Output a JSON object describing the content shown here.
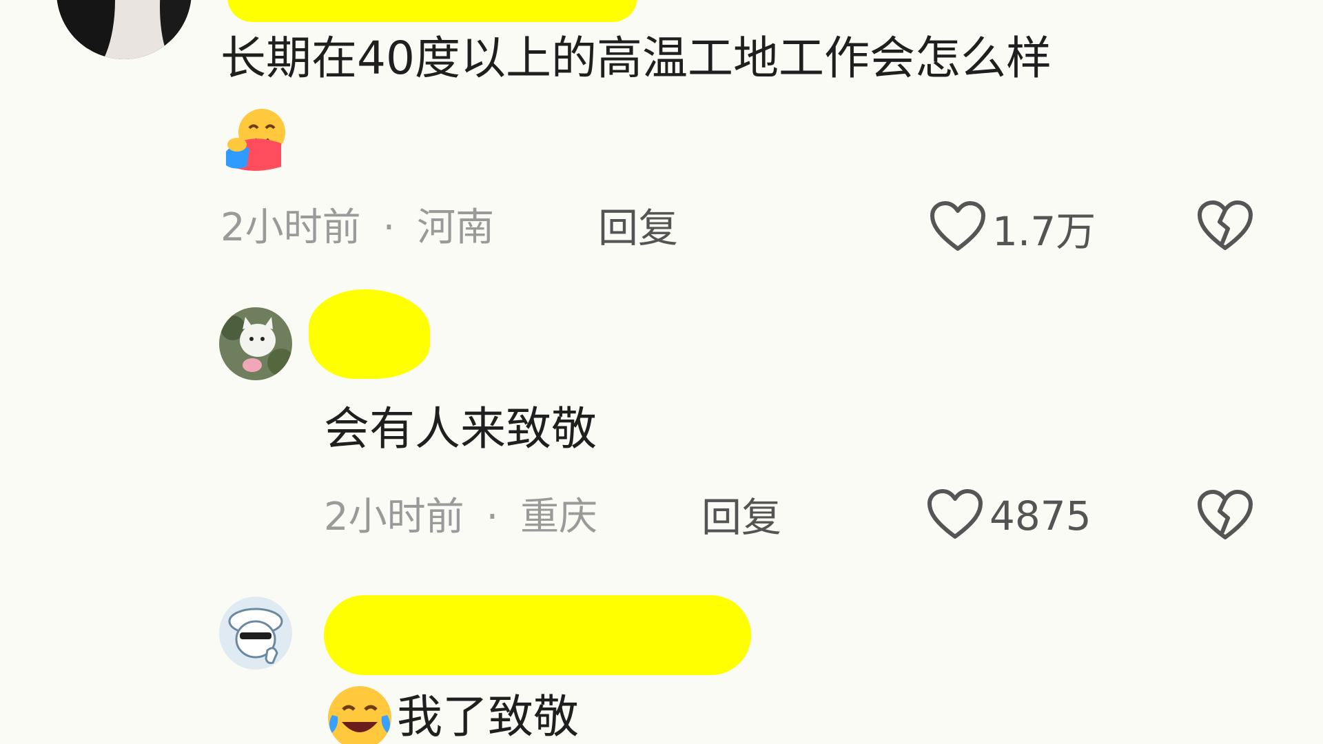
{
  "comments": [
    {
      "text": "长期在40度以上的高温工地工作会怎么样",
      "emoji_icon": "hugging-face-emoji",
      "time": "2小时前",
      "separator": "·",
      "location": "河南",
      "reply_label": "回复",
      "like_count": "1.7万"
    },
    {
      "text": "会有人来致敬",
      "time": "2小时前",
      "separator": "·",
      "location": "重庆",
      "reply_label": "回复",
      "like_count": "4875"
    },
    {
      "emoji_icon": "rofl-emoji",
      "text": "我了致敬"
    }
  ],
  "icons": {
    "like": "heart-outline-icon",
    "dislike": "broken-heart-icon"
  },
  "colors": {
    "background": "#fbfbf5",
    "text": "#1f1f1f",
    "meta": "#9a9a9a",
    "action": "#545454",
    "redaction": "#ffff00"
  }
}
